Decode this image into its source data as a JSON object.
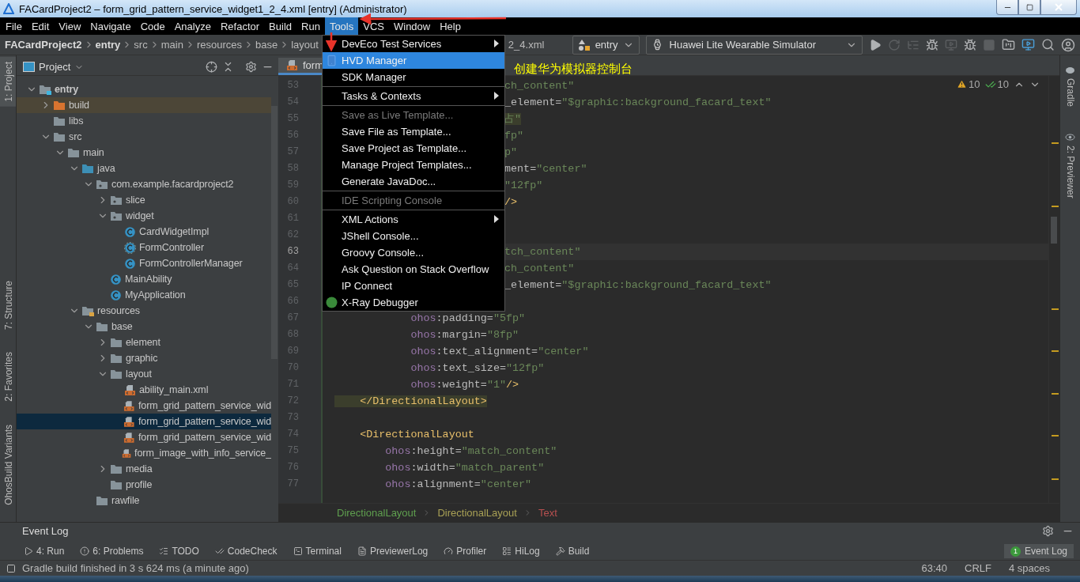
{
  "window": {
    "title": "FACardProject2 – form_grid_pattern_service_widget1_2_4.xml [entry] (Administrator)"
  },
  "menu_bar": [
    {
      "label": "File",
      "selected": false
    },
    {
      "label": "Edit",
      "selected": false
    },
    {
      "label": "View",
      "selected": false
    },
    {
      "label": "Navigate",
      "selected": false
    },
    {
      "label": "Code",
      "selected": false
    },
    {
      "label": "Analyze",
      "selected": false
    },
    {
      "label": "Refactor",
      "selected": false
    },
    {
      "label": "Build",
      "selected": false
    },
    {
      "label": "Run",
      "selected": false
    },
    {
      "label": "Tools",
      "selected": true
    },
    {
      "label": "VCS",
      "selected": false
    },
    {
      "label": "Window",
      "selected": false
    },
    {
      "label": "Help",
      "selected": false
    }
  ],
  "navigation": {
    "crumbs": [
      {
        "label": "FACardProject2",
        "kind": "project"
      },
      {
        "label": "entry",
        "kind": "module"
      },
      {
        "label": "src",
        "kind": "folder"
      },
      {
        "label": "main",
        "kind": "folder"
      },
      {
        "label": "resources",
        "kind": "folder"
      },
      {
        "label": "base",
        "kind": "folder"
      },
      {
        "label": "layout",
        "kind": "folder"
      },
      {
        "label": "2_4.xml",
        "kind": "covered-file"
      }
    ],
    "run_config": "entry",
    "device": "Huawei Lite Wearable Simulator"
  },
  "left_strip": [
    {
      "label": "1: Project",
      "selected": true
    },
    {
      "label": "7: Structure",
      "selected": false
    },
    {
      "label": "2: Favorites",
      "selected": false
    },
    {
      "label": "OhosBuild Variants",
      "selected": false
    }
  ],
  "project_panel": {
    "title": "Project",
    "tree": [
      {
        "label": "entry",
        "kind": "module",
        "expanded": true,
        "selected": false,
        "children": [
          {
            "label": "build",
            "kind": "excluded",
            "expanded": false,
            "selected": false
          },
          {
            "label": "libs",
            "kind": "folder",
            "selected": false
          },
          {
            "label": "src",
            "kind": "folder",
            "expanded": true,
            "selected": false,
            "children": [
              {
                "label": "main",
                "kind": "folder",
                "expanded": true,
                "selected": false,
                "children": [
                  {
                    "label": "java",
                    "kind": "source",
                    "expanded": true,
                    "selected": false,
                    "children": [
                      {
                        "label": "com.example.facardproject2",
                        "kind": "package",
                        "expanded": true,
                        "selected": false,
                        "children": [
                          {
                            "label": "slice",
                            "kind": "package",
                            "expanded": false,
                            "selected": false
                          },
                          {
                            "label": "widget",
                            "kind": "package",
                            "expanded": true,
                            "selected": false,
                            "children": [
                              {
                                "label": "CardWidgetImpl",
                                "kind": "class",
                                "selected": false
                              },
                              {
                                "label": "FormController",
                                "kind": "abstract-class",
                                "selected": false
                              },
                              {
                                "label": "FormControllerManager",
                                "kind": "class",
                                "selected": false
                              }
                            ]
                          },
                          {
                            "label": "MainAbility",
                            "kind": "class",
                            "selected": false
                          },
                          {
                            "label": "MyApplication",
                            "kind": "class",
                            "selected": false
                          }
                        ]
                      }
                    ]
                  },
                  {
                    "label": "resources",
                    "kind": "resources",
                    "expanded": true,
                    "selected": false,
                    "children": [
                      {
                        "label": "base",
                        "kind": "folder",
                        "expanded": true,
                        "selected": false,
                        "children": [
                          {
                            "label": "element",
                            "kind": "folder",
                            "expanded": false,
                            "selected": false
                          },
                          {
                            "label": "graphic",
                            "kind": "folder",
                            "expanded": false,
                            "selected": false
                          },
                          {
                            "label": "layout",
                            "kind": "folder",
                            "expanded": true,
                            "selected": false,
                            "children": [
                              {
                                "label": "ability_main.xml",
                                "kind": "xml",
                                "selected": false
                              },
                              {
                                "label": "form_grid_pattern_service_wid",
                                "kind": "xml",
                                "selected": false
                              },
                              {
                                "label": "form_grid_pattern_service_wid",
                                "kind": "xml",
                                "selected": true
                              },
                              {
                                "label": "form_grid_pattern_service_wid",
                                "kind": "xml",
                                "selected": false
                              },
                              {
                                "label": "form_image_with_info_service_",
                                "kind": "xml",
                                "selected": false
                              }
                            ]
                          },
                          {
                            "label": "media",
                            "kind": "folder",
                            "expanded": false,
                            "selected": false
                          },
                          {
                            "label": "profile",
                            "kind": "folder",
                            "selected": false
                          }
                        ]
                      },
                      {
                        "label": "rawfile",
                        "kind": "folder",
                        "selected": false
                      }
                    ]
                  }
                ]
              }
            ]
          }
        ]
      }
    ]
  },
  "editor": {
    "tabs": [
      {
        "label": "form",
        "selected": true
      }
    ],
    "annotation": "创建华为模拟器控制台",
    "inspections": {
      "warnings": "10",
      "passed": "10"
    },
    "lines": [
      {
        "number": "53",
        "clipped": true,
        "current": false,
        "tokens": [
          {
            "kind": "str",
            "text": "ch_content\""
          }
        ]
      },
      {
        "number": "54",
        "clipped": true,
        "current": false,
        "tokens": [
          {
            "kind": "attr",
            "text": "_element="
          },
          {
            "kind": "str",
            "text": "\"$graphic:background_facard_text\""
          }
        ]
      },
      {
        "number": "55",
        "clipped": true,
        "current": false,
        "tokens": [
          {
            "kind": "str-match",
            "text": "占\""
          }
        ]
      },
      {
        "number": "56",
        "clipped": true,
        "current": false,
        "tokens": [
          {
            "kind": "str",
            "text": "fp\""
          }
        ]
      },
      {
        "number": "57",
        "clipped": true,
        "current": false,
        "tokens": [
          {
            "kind": "str",
            "text": "p\""
          }
        ]
      },
      {
        "number": "58",
        "clipped": true,
        "current": false,
        "tokens": [
          {
            "kind": "attr",
            "text": "ment="
          },
          {
            "kind": "str",
            "text": "\"center\""
          }
        ]
      },
      {
        "number": "59",
        "clipped": true,
        "current": false,
        "tokens": [
          {
            "kind": "str",
            "text": "\"12fp\""
          }
        ]
      },
      {
        "number": "60",
        "clipped": true,
        "current": false,
        "tokens": [
          {
            "kind": "tag",
            "text": "/>"
          }
        ]
      },
      {
        "number": "61",
        "current": false
      },
      {
        "number": "62",
        "current": false
      },
      {
        "number": "63",
        "clipped": true,
        "current": true,
        "tokens": [
          {
            "kind": "str",
            "text": "tch_content\""
          }
        ]
      },
      {
        "number": "64",
        "clipped": true,
        "current": false,
        "tokens": [
          {
            "kind": "str",
            "text": "ch_content\""
          }
        ]
      },
      {
        "number": "65",
        "clipped": true,
        "current": false,
        "tokens": [
          {
            "kind": "attr",
            "text": "_element="
          },
          {
            "kind": "str",
            "text": "\"$graphic:background_facard_text\""
          }
        ]
      },
      {
        "number": "66",
        "current": false
      },
      {
        "number": "67",
        "clipped": false,
        "current": false,
        "tokens": [
          {
            "kind": "ns",
            "text": "            ohos"
          },
          {
            "kind": "attr",
            "text": ":padding="
          },
          {
            "kind": "str",
            "text": "\"5fp\""
          }
        ]
      },
      {
        "number": "68",
        "clipped": false,
        "current": false,
        "tokens": [
          {
            "kind": "ns",
            "text": "            ohos"
          },
          {
            "kind": "attr",
            "text": ":margin="
          },
          {
            "kind": "str",
            "text": "\"8fp\""
          }
        ]
      },
      {
        "number": "69",
        "clipped": false,
        "current": false,
        "tokens": [
          {
            "kind": "ns",
            "text": "            ohos"
          },
          {
            "kind": "attr",
            "text": ":text_alignment="
          },
          {
            "kind": "str",
            "text": "\"center\""
          }
        ]
      },
      {
        "number": "70",
        "clipped": false,
        "current": false,
        "tokens": [
          {
            "kind": "ns",
            "text": "            ohos"
          },
          {
            "kind": "attr",
            "text": ":text_size="
          },
          {
            "kind": "str",
            "text": "\"12fp\""
          }
        ]
      },
      {
        "number": "71",
        "clipped": false,
        "current": false,
        "tokens": [
          {
            "kind": "ns",
            "text": "            ohos"
          },
          {
            "kind": "attr",
            "text": ":weight="
          },
          {
            "kind": "str",
            "text": "\"1\""
          },
          {
            "kind": "tag",
            "text": "/>"
          }
        ]
      },
      {
        "number": "72",
        "clipped": false,
        "current": false,
        "tokens": [
          {
            "kind": "tag-match",
            "text": "    </DirectionalLayout>"
          }
        ]
      },
      {
        "number": "73",
        "current": false
      },
      {
        "number": "74",
        "clipped": false,
        "current": false,
        "tokens": [
          {
            "kind": "tag",
            "text": "    <DirectionalLayout"
          }
        ]
      },
      {
        "number": "75",
        "clipped": false,
        "current": false,
        "tokens": [
          {
            "kind": "ns",
            "text": "        ohos"
          },
          {
            "kind": "attr",
            "text": ":height="
          },
          {
            "kind": "str",
            "text": "\"match_content\""
          }
        ]
      },
      {
        "number": "76",
        "clipped": false,
        "current": false,
        "tokens": [
          {
            "kind": "ns",
            "text": "        ohos"
          },
          {
            "kind": "attr",
            "text": ":width="
          },
          {
            "kind": "str",
            "text": "\"match_parent\""
          }
        ]
      },
      {
        "number": "77",
        "clipped": false,
        "current": false,
        "tokens": [
          {
            "kind": "ns",
            "text": "        ohos"
          },
          {
            "kind": "attr",
            "text": ":alignment="
          },
          {
            "kind": "str",
            "text": "\"center\""
          }
        ]
      }
    ],
    "breadcrumb": [
      {
        "label": "DirectionalLayout",
        "color": "#5f9f4f"
      },
      {
        "label": "DirectionalLayout",
        "color": "#a8a055"
      },
      {
        "label": "Text",
        "color": "#b75050"
      }
    ]
  },
  "right_strip": [
    {
      "label": "Gradle"
    },
    {
      "label": "2: Previewer"
    }
  ],
  "tools_menu": [
    {
      "kind": "submenu",
      "label": "DevEco Test Services",
      "selected": false,
      "disabled": false
    },
    {
      "kind": "item",
      "label": "HVD Manager",
      "selected": true,
      "disabled": false
    },
    {
      "kind": "item",
      "label": "SDK Manager",
      "selected": false,
      "disabled": false
    },
    {
      "kind": "separator"
    },
    {
      "kind": "submenu",
      "label": "Tasks & Contexts",
      "selected": false,
      "disabled": false
    },
    {
      "kind": "separator"
    },
    {
      "kind": "item",
      "label": "Save as Live Template...",
      "selected": false,
      "disabled": true
    },
    {
      "kind": "item",
      "label": "Save File as Template...",
      "selected": false,
      "disabled": false
    },
    {
      "kind": "item",
      "label": "Save Project as Template...",
      "selected": false,
      "disabled": false
    },
    {
      "kind": "item",
      "label": "Manage Project Templates...",
      "selected": false,
      "disabled": false
    },
    {
      "kind": "item",
      "label": "Generate JavaDoc...",
      "selected": false,
      "disabled": false
    },
    {
      "kind": "separator"
    },
    {
      "kind": "item",
      "label": "IDE Scripting Console",
      "selected": false,
      "disabled": true
    },
    {
      "kind": "separator"
    },
    {
      "kind": "submenu",
      "label": "XML Actions",
      "selected": false,
      "disabled": false
    },
    {
      "kind": "item",
      "label": "JShell Console...",
      "selected": false,
      "disabled": false
    },
    {
      "kind": "item",
      "label": "Groovy Console...",
      "selected": false,
      "disabled": false
    },
    {
      "kind": "item",
      "label": "Ask Question on Stack Overflow",
      "selected": false,
      "disabled": false
    },
    {
      "kind": "item",
      "label": "IP Connect",
      "selected": false,
      "disabled": false
    },
    {
      "kind": "item",
      "label": "X-Ray Debugger",
      "selected": false,
      "disabled": false
    }
  ],
  "event_log": {
    "title": "Event Log"
  },
  "tool_buttons": [
    {
      "label": "4: Run"
    },
    {
      "label": "6: Problems"
    },
    {
      "label": "TODO"
    },
    {
      "label": "CodeCheck"
    },
    {
      "label": "Terminal"
    },
    {
      "label": "PreviewerLog"
    },
    {
      "label": "Profiler"
    },
    {
      "label": "HiLog"
    },
    {
      "label": "Build"
    }
  ],
  "event_log_button": {
    "label": "Event Log",
    "badge": "1"
  },
  "status_bar": {
    "message": "Gradle build finished in 3 s 624 ms (a minute ago)",
    "position": "63:40",
    "line_separator": "CRLF",
    "indent": "4 spaces"
  }
}
